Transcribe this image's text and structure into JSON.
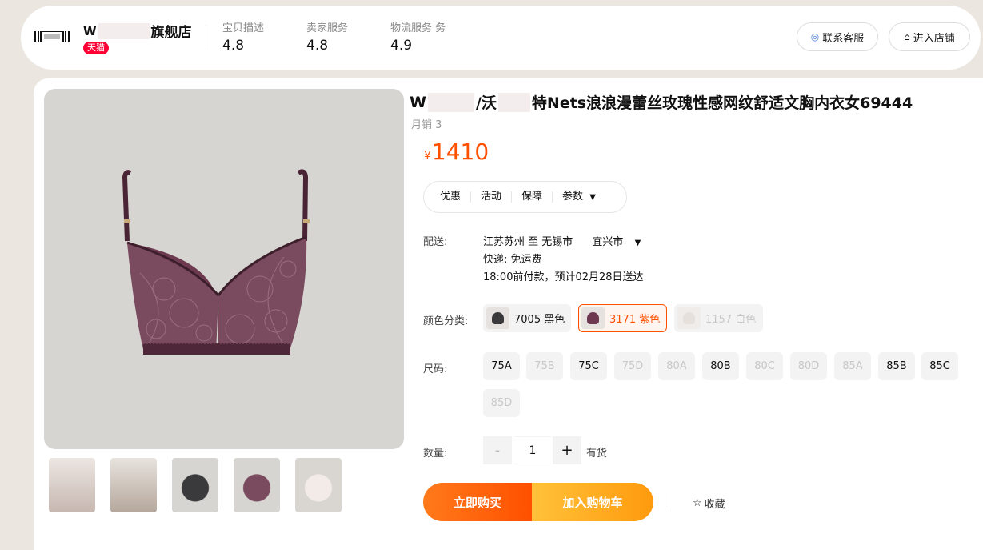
{
  "store": {
    "name_prefix": "W",
    "name_suffix": "旗舰店",
    "tag": "天猫",
    "scores": [
      {
        "label": "宝贝描述",
        "value": "4.8"
      },
      {
        "label": "卖家服务",
        "value": "4.8"
      },
      {
        "label": "物流服务 务",
        "value": "4.9"
      }
    ],
    "contact_label": "联系客服",
    "enter_label": "进入店铺"
  },
  "product": {
    "title_prefix": "W",
    "title_mid": "/沃",
    "title_suffix": "特Nets浪浪漫蕾丝玫瑰性感网纹舒适文胸内衣女69444",
    "sales": "月销 3",
    "currency": "¥",
    "price": "1410"
  },
  "tabs": [
    "优惠",
    "活动",
    "保障",
    "参数"
  ],
  "shipping": {
    "label": "配送:",
    "route": "江苏苏州 至 无锡市",
    "district": "宜兴市",
    "express": "快递: 免运费",
    "eta": "18:00前付款，预计02月28日送达"
  },
  "colors": {
    "label": "颜色分类:",
    "options": [
      {
        "label": "7005 黑色",
        "state": "normal",
        "swatch": "#3a3a3c"
      },
      {
        "label": "3171 紫色",
        "state": "selected",
        "swatch": "#6e3850"
      },
      {
        "label": "1157 白色",
        "state": "disabled",
        "swatch": "#e6e0dc"
      }
    ]
  },
  "sizes": {
    "label": "尺码:",
    "options": [
      {
        "label": "75A",
        "available": true
      },
      {
        "label": "75B",
        "available": false
      },
      {
        "label": "75C",
        "available": true
      },
      {
        "label": "75D",
        "available": false
      },
      {
        "label": "80A",
        "available": false
      },
      {
        "label": "80B",
        "available": true
      },
      {
        "label": "80C",
        "available": false
      },
      {
        "label": "80D",
        "available": false
      },
      {
        "label": "85A",
        "available": false
      },
      {
        "label": "85B",
        "available": true
      },
      {
        "label": "85C",
        "available": true
      },
      {
        "label": "85D",
        "available": false
      }
    ]
  },
  "quantity": {
    "label": "数量:",
    "minus": "-",
    "value": "1",
    "plus": "+",
    "stock": "有货"
  },
  "actions": {
    "buy_now": "立即购买",
    "add_to_cart": "加入购物车",
    "favorite": "收藏"
  },
  "colors_theme": {
    "accent": "#ff5000",
    "tmall_red": "#ff0036",
    "product_plum": "#5e2f42",
    "image_bg": "#d6d5d1"
  }
}
